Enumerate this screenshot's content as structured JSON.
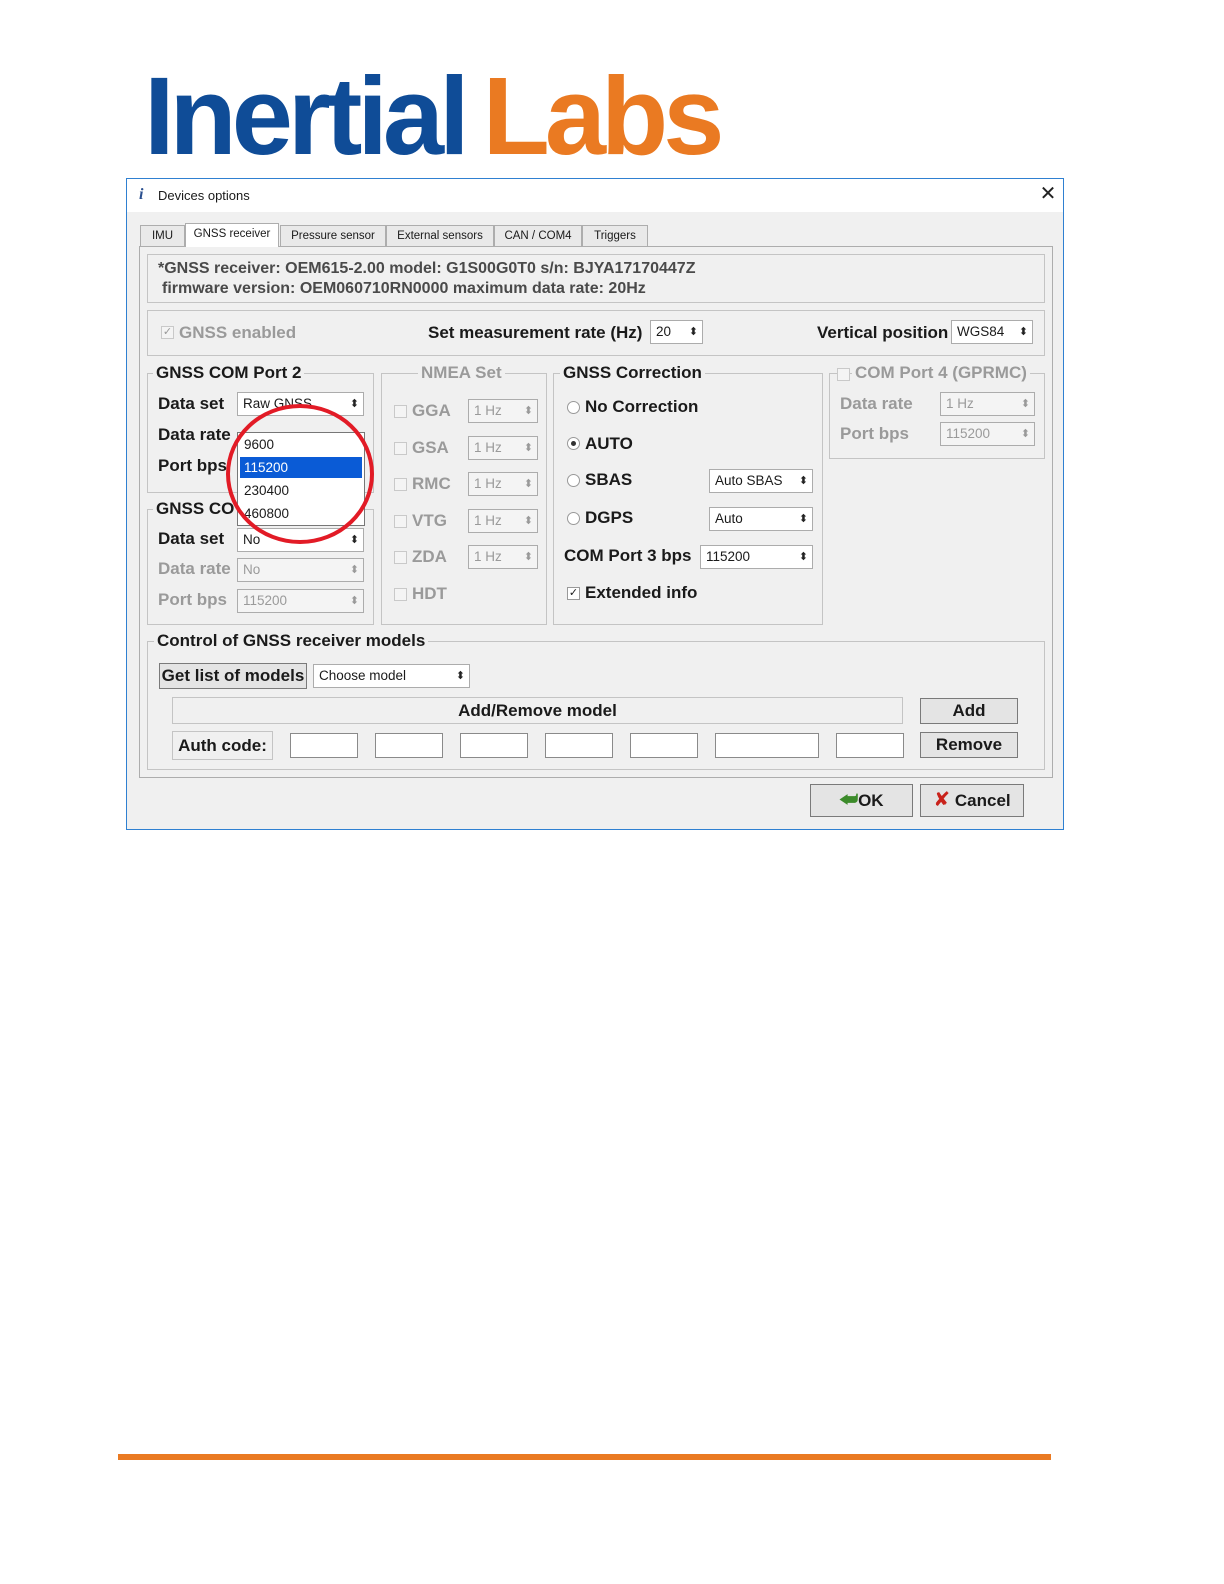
{
  "logo": {
    "part1": "Inertial",
    "part2": "Labs"
  },
  "window": {
    "title": "Devices options"
  },
  "tabs": [
    "IMU",
    "GNSS receiver",
    "Pressure sensor",
    "External sensors",
    "CAN / COM4",
    "Triggers"
  ],
  "info": {
    "line1": "*GNSS receiver: OEM615-2.00 model: G1S00G0T0 s/n: BJYA17170447Z",
    "line2": "firmware version: OEM060710RN0000 maximum data rate: 20Hz"
  },
  "top_row": {
    "gnss_enabled_label": "GNSS enabled",
    "gnss_enabled_check": "✓",
    "rate_label": "Set measurement rate (Hz)",
    "rate_value": "20",
    "vpos_label": "Vertical position",
    "vpos_value": "WGS84"
  },
  "com2": {
    "title": "GNSS COM Port 2",
    "data_set_label": "Data set",
    "data_set_value": "Raw GNSS",
    "data_rate_label": "Data rate",
    "port_bps_label": "Port bps"
  },
  "baud_dropdown": {
    "options": [
      "9600",
      "115200",
      "230400",
      "460800"
    ],
    "selected": "115200"
  },
  "com_other": {
    "title": "GNSS CO",
    "data_set_label": "Data set",
    "data_set_value": "No",
    "data_rate_label": "Data rate",
    "data_rate_value": "No",
    "port_bps_label": "Port bps",
    "port_bps_value": "115200"
  },
  "nmea": {
    "title": "NMEA Set",
    "items": [
      {
        "label": "GGA",
        "rate": "1 Hz"
      },
      {
        "label": "GSA",
        "rate": "1 Hz"
      },
      {
        "label": "RMC",
        "rate": "1 Hz"
      },
      {
        "label": "VTG",
        "rate": "1 Hz"
      },
      {
        "label": "ZDA",
        "rate": "1 Hz"
      },
      {
        "label": "HDT"
      }
    ]
  },
  "correction": {
    "title": "GNSS Correction",
    "no_correction": "No Correction",
    "auto": "AUTO",
    "sbas": "SBAS",
    "sbas_value": "Auto SBAS",
    "dgps": "DGPS",
    "dgps_value": "Auto",
    "com3_label": "COM Port 3 bps",
    "com3_value": "115200",
    "extended_label": "Extended info",
    "extended_check": "✓",
    "selected": "AUTO"
  },
  "com4": {
    "title": "COM Port 4 (GPRMC)",
    "data_rate_label": "Data rate",
    "data_rate_value": "1 Hz",
    "port_bps_label": "Port bps",
    "port_bps_value": "115200"
  },
  "models": {
    "title": "Control of GNSS receiver models",
    "get_list": "Get list of models",
    "choose": "Choose model",
    "add_remove": "Add/Remove model",
    "auth_label": "Auth code:",
    "add": "Add",
    "remove": "Remove"
  },
  "buttons": {
    "ok": "OK",
    "cancel": "Cancel"
  },
  "icons": {
    "window": "info-icon",
    "ok": "green-arrow-icon",
    "cancel": "red-x-icon",
    "close": "close-icon",
    "annotation": "red-circle-highlight"
  },
  "colors": {
    "logo_blue": "#0f4c97",
    "logo_orange": "#ea7a22",
    "window_border": "#2f80d1",
    "highlight": "#e21b26",
    "selection": "#0a5bd6"
  }
}
